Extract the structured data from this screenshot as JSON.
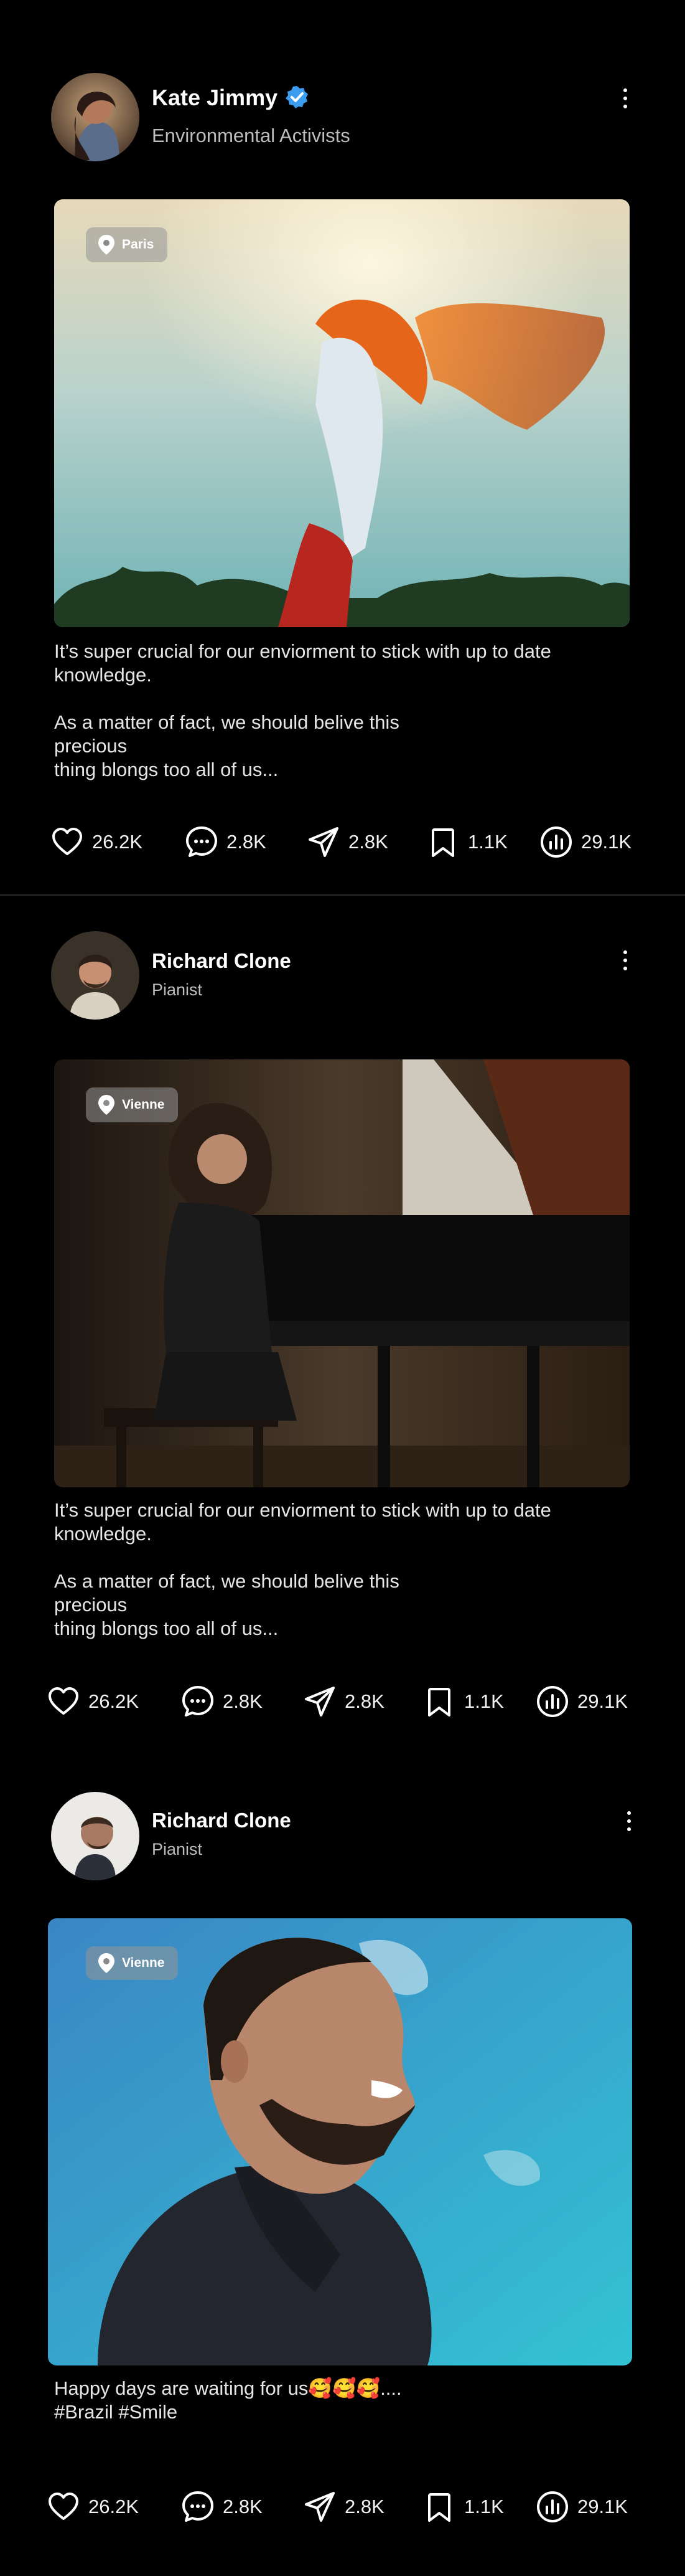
{
  "posts": [
    {
      "author": "Kate Jimmy",
      "verified": true,
      "role": "Environmental Activists",
      "location": "Paris",
      "premium_icon": "crown-icon",
      "caption": [
        "It’s super crucial for our enviorment to stick with up to date knowledge.",
        "As a matter of fact, we should belive this precious",
        "thing blongs too all of us..."
      ],
      "stats": {
        "likes": "26.2K",
        "comments": "2.8K",
        "shares": "2.8K",
        "saves": "1.1K",
        "views": "29.1K"
      }
    },
    {
      "author": "Richard Clone",
      "verified": false,
      "role": "Pianist",
      "location": "Vienne",
      "caption": [
        "It’s super crucial for our enviorment to stick with up to date knowledge.",
        "As a matter of fact, we should belive this precious",
        "thing blongs too all of us..."
      ],
      "stats": {
        "likes": "26.2K",
        "comments": "2.8K",
        "shares": "2.8K",
        "saves": "1.1K",
        "views": "29.1K"
      }
    },
    {
      "author": "Richard Clone",
      "verified": false,
      "role": "Pianist",
      "location": "Vienne",
      "caption": [
        "Happy days are waiting for us🥰🥰🥰....",
        "#Brazil #Smile"
      ],
      "stats": {
        "likes": "26.2K",
        "comments": "2.8K",
        "shares": "2.8K",
        "saves": "1.1K",
        "views": "29.1K"
      }
    }
  ],
  "colors": {
    "background": "#000000",
    "verified_badge": "#3b9cf0",
    "premium": "#f4a227",
    "location_chip": "#8c8c8c"
  }
}
